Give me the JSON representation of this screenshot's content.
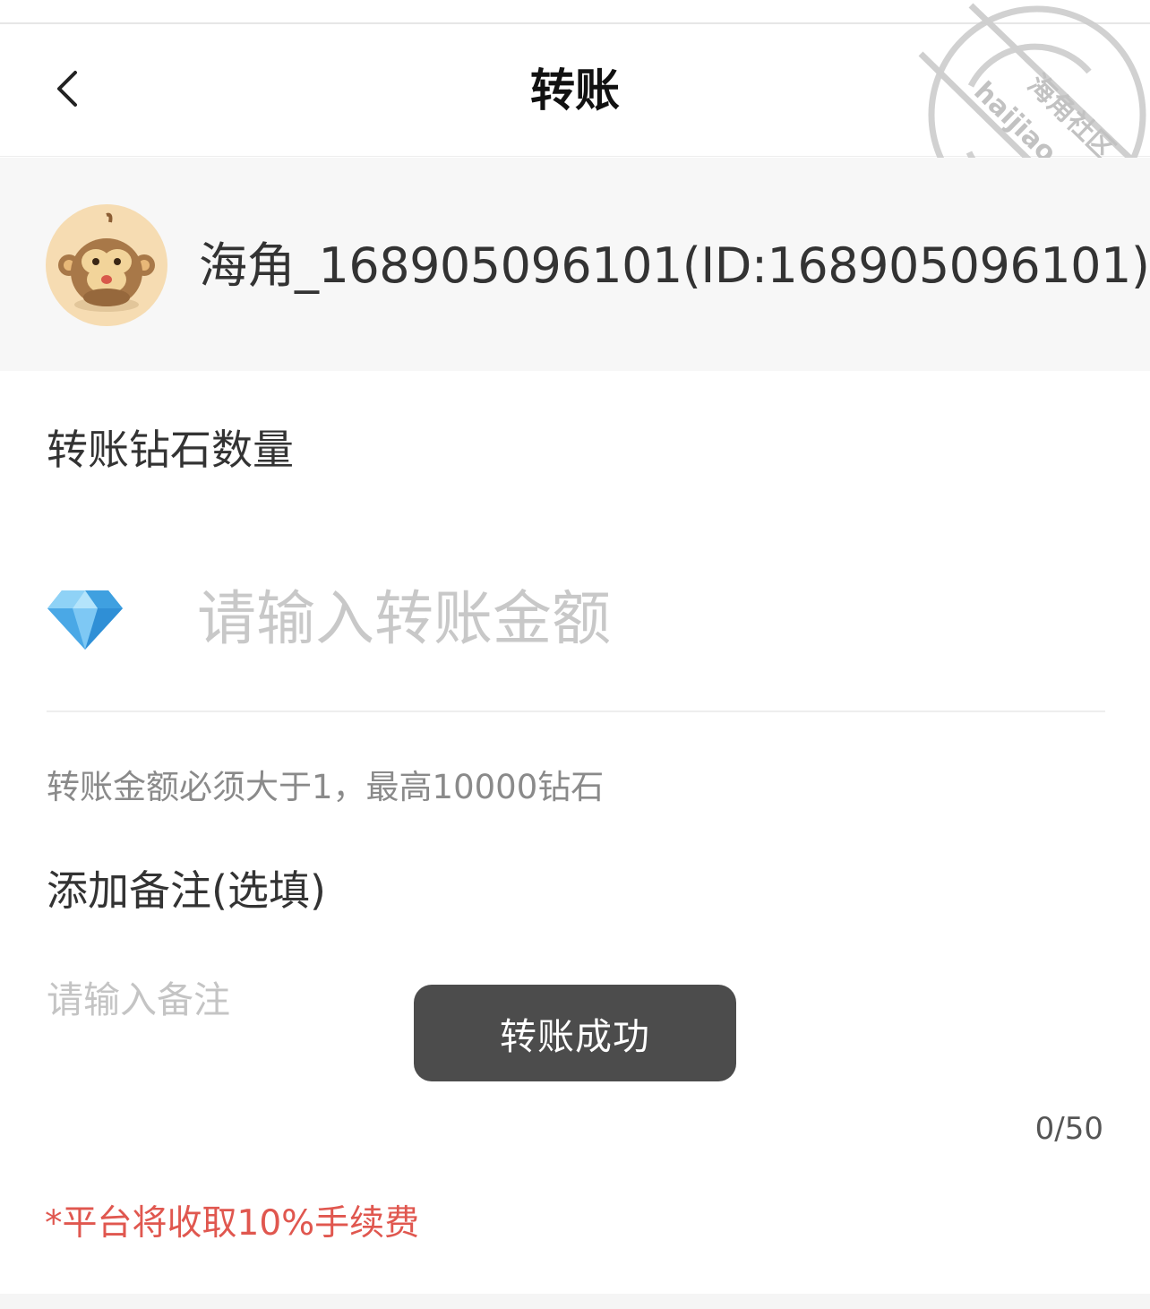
{
  "header": {
    "title": "转账",
    "back_icon": "chevron-left-icon"
  },
  "recipient": {
    "name": "海角_168905096101(ID:168905096101)",
    "avatar": "monkey-avatar"
  },
  "amount": {
    "label": "转账钻石数量",
    "icon": "diamond-icon",
    "placeholder": "请输入转账金额",
    "value": "",
    "hint": "转账金额必须大于1，最高10000钻石"
  },
  "note": {
    "label": "添加备注(选填)",
    "placeholder": "请输入备注",
    "value": "",
    "char_count": "0/50"
  },
  "fee_notice": "*平台将收取10%手续费",
  "toast": {
    "text": "转账成功"
  },
  "watermark": {
    "text_cn": "海角社区",
    "text_en": "haijiao.com"
  },
  "colors": {
    "fee_notice": "#e0574f",
    "toast_bg": "#4c4c4c",
    "card_bg": "#f7f7f7",
    "placeholder": "#c8c8c8"
  }
}
